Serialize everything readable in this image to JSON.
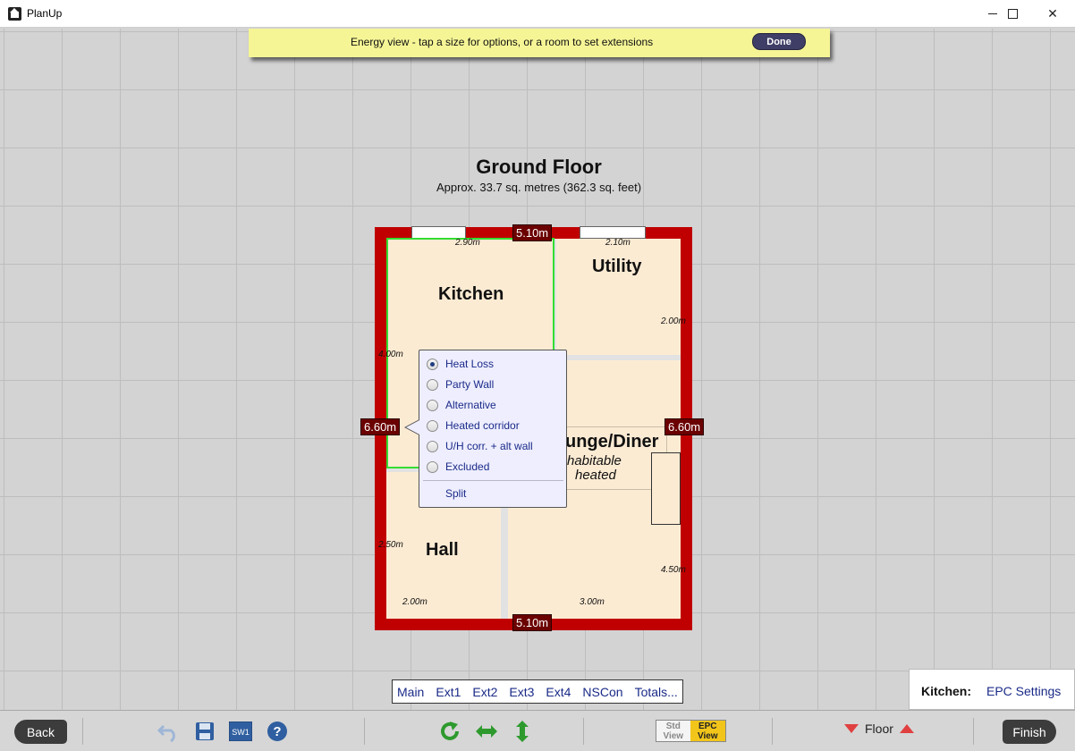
{
  "window": {
    "title": "PlanUp"
  },
  "banner": {
    "text": "Energy view - tap a size for options, or a room to set extensions",
    "done_label": "Done"
  },
  "floor": {
    "title": "Ground Floor",
    "area_text": "Approx. 33.7 sq. metres (362.3 sq. feet)"
  },
  "rooms": {
    "kitchen": "Kitchen",
    "utility": "Utility",
    "lounge": "unge/Diner",
    "lounge_sub1": "habitable",
    "lounge_sub2": "heated",
    "hall": "Hall"
  },
  "dimensions": {
    "top": "5.10m",
    "bottom": "5.10m",
    "left": "6.60m",
    "right": "6.60m",
    "kitchen_width": "2.90m",
    "utility_width": "2.10m",
    "utility_height": "2.00m",
    "kitchen_height": "4.00m",
    "hall_height": "2.50m",
    "hall_width": "2.00m",
    "lounge_width": "3.00m",
    "lounge_height": "4.50m"
  },
  "popup": {
    "options": [
      "Heat Loss",
      "Party Wall",
      "Alternative",
      "Heated corridor",
      "U/H corr. + alt wall",
      "Excluded"
    ],
    "selected": "Heat Loss",
    "split_label": "Split"
  },
  "ext_tabs": [
    "Main",
    "Ext1",
    "Ext2",
    "Ext3",
    "Ext4",
    "NSCon",
    "Totals..."
  ],
  "room_panel": {
    "name": "Kitchen:",
    "link": "EPC Settings"
  },
  "toolbar": {
    "back_label": "Back",
    "finish_label": "Finish",
    "sw1_label": "SW1",
    "std_view_1": "Std",
    "std_view_2": "View",
    "epc_view_1": "EPC",
    "epc_view_2": "View",
    "floor_label": "Floor"
  },
  "colors": {
    "wall": "#c00000",
    "room_fill": "#fcebd3",
    "selection": "#33dd33",
    "dim_tag": "#6b0000",
    "banner": "#f5f596",
    "accent_link": "#1a2a88"
  }
}
